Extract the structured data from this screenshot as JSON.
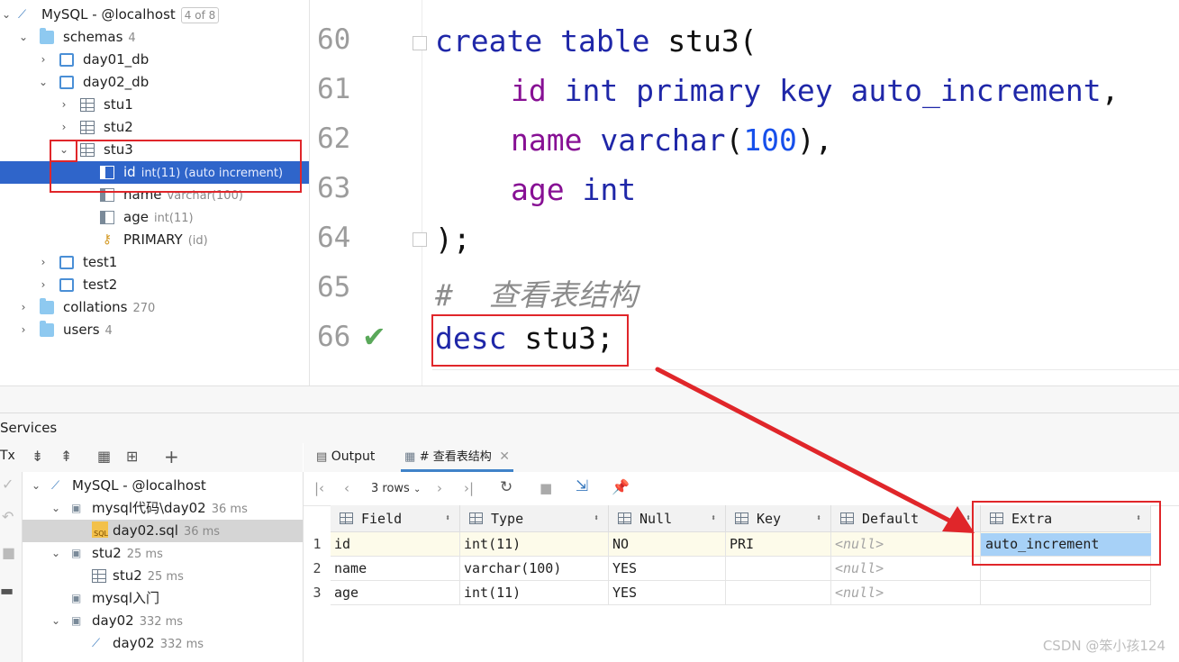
{
  "db_tree": {
    "root": {
      "label": "MySQL - @localhost",
      "badge": "4 of 8"
    },
    "schemas": {
      "label": "schemas",
      "count": "4"
    },
    "day01": "day01_db",
    "day02": "day02_db",
    "stu1": "stu1",
    "stu2": "stu2",
    "stu3": "stu3",
    "id_col": {
      "label": "id",
      "meta": "int(11) (auto increment)"
    },
    "name_col": {
      "label": "name",
      "meta": "varchar(100)"
    },
    "age_col": {
      "label": "age",
      "meta": "int(11)"
    },
    "primary": {
      "label": "PRIMARY",
      "meta": "(id)"
    },
    "test1": "test1",
    "test2": "test2",
    "collations": {
      "label": "collations",
      "count": "270"
    },
    "users": {
      "label": "users",
      "count": "4"
    }
  },
  "editor": {
    "line_numbers": [
      "60",
      "61",
      "62",
      "63",
      "64",
      "65",
      "66"
    ],
    "l60": {
      "kw1": "create",
      "kw2": "table",
      "rest": "stu3("
    },
    "l61": {
      "f": "id",
      "kw": "int primary key auto_increment",
      "p": ","
    },
    "l62": {
      "f": "name",
      "kw": "varchar",
      "p1": "(",
      "n": "100",
      "p2": "),"
    },
    "l63": {
      "f": "age",
      "kw": "int"
    },
    "l64": ");",
    "l65": "#  查看表结构",
    "l66": {
      "kw": "desc",
      "rest": " stu3;"
    }
  },
  "services": {
    "title": "Services",
    "tree": {
      "root": "MySQL - @localhost",
      "n1": {
        "label": "mysql代码\\day02",
        "time": "36 ms"
      },
      "n1a": {
        "label": "day02.sql",
        "time": "36 ms"
      },
      "n2": {
        "label": "stu2",
        "time": "25 ms"
      },
      "n2a": {
        "label": "stu2",
        "time": "25 ms"
      },
      "n3": {
        "label": "mysql入门"
      },
      "n4": {
        "label": "day02",
        "time": "332 ms"
      },
      "n4a": {
        "label": "day02",
        "time": "332 ms"
      }
    },
    "left_tx": "Tx"
  },
  "result": {
    "tabs": [
      {
        "label": "Output"
      },
      {
        "label": "# 查看表结构"
      }
    ],
    "rows_label": "3 rows",
    "columns": [
      "Field",
      "Type",
      "Null",
      "Key",
      "Default",
      "Extra"
    ],
    "rows": [
      {
        "n": "1",
        "field": "id",
        "type": "int(11)",
        "null": "NO",
        "key": "PRI",
        "default": "<null>",
        "extra": "auto_increment"
      },
      {
        "n": "2",
        "field": "name",
        "type": "varchar(100)",
        "null": "YES",
        "key": "",
        "default": "<null>",
        "extra": ""
      },
      {
        "n": "3",
        "field": "age",
        "type": "int(11)",
        "null": "YES",
        "key": "",
        "default": "<null>",
        "extra": ""
      }
    ]
  },
  "watermark": "CSDN @笨小孩124",
  "colors": {
    "selection": "#2f65ca",
    "annotation_red": "#e0262a",
    "keyword": "#1f27a8",
    "field": "#871094",
    "number": "#1750eb"
  },
  "icons": [
    "chevron-down-icon",
    "chevron-right-icon",
    "folder-icon",
    "schema-icon",
    "table-icon",
    "column-icon",
    "key-icon",
    "checkmark-icon",
    "run-icon",
    "refresh-icon",
    "stop-icon",
    "pin-icon"
  ]
}
